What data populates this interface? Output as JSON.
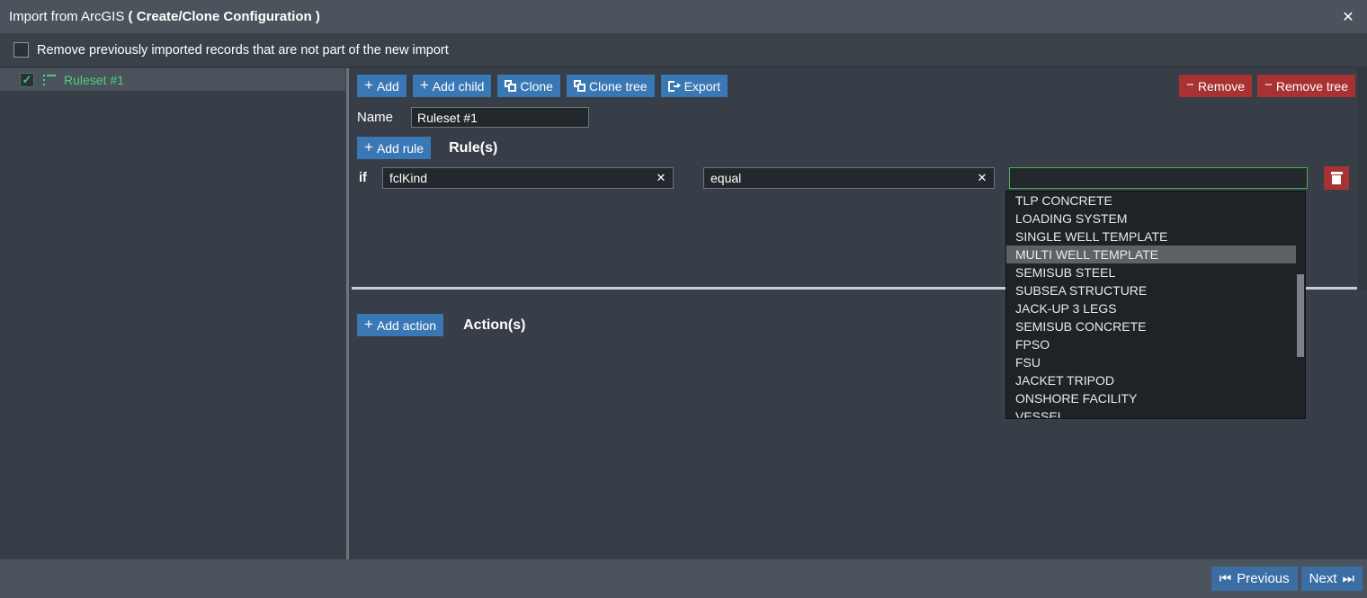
{
  "window": {
    "title_main": "Import from ArcGIS",
    "title_bold": "( Create/Clone Configuration )",
    "close_label": "✕"
  },
  "options": {
    "remove_previous_label": "Remove previously imported records that are not part of the new import",
    "remove_previous_checked": false
  },
  "tree": {
    "items": [
      {
        "label": "Ruleset #1",
        "checked": true,
        "check_glyph": "✓"
      }
    ]
  },
  "toolbar": {
    "add_label": "Add",
    "add_child_label": "Add child",
    "clone_label": "Clone",
    "clone_tree_label": "Clone tree",
    "export_label": "Export",
    "remove_label": "Remove",
    "remove_tree_label": "Remove tree",
    "plus_glyph": "+",
    "minus_glyph": "−"
  },
  "name_field": {
    "label": "Name",
    "value": "Ruleset #1"
  },
  "rules_section": {
    "add_rule_label": "Add rule",
    "title": "Rule(s)",
    "rule": {
      "if_label": "if",
      "field_value": "fclKind",
      "field_clear": "✕",
      "operator_value": "equal",
      "operator_clear": "✕",
      "value_text": ""
    }
  },
  "dropdown": {
    "selected": "MULTI WELL TEMPLATE",
    "items": [
      "TLP CONCRETE",
      "LOADING SYSTEM",
      "SINGLE WELL TEMPLATE",
      "MULTI WELL TEMPLATE",
      "SEMISUB STEEL",
      "SUBSEA STRUCTURE",
      "JACK-UP 3 LEGS",
      "SEMISUB CONCRETE",
      "FPSO",
      "FSU",
      "JACKET TRIPOD",
      "ONSHORE FACILITY",
      "VESSEL"
    ]
  },
  "actions_section": {
    "add_action_label": "Add action",
    "title": "Action(s)"
  },
  "footer": {
    "previous_label": "Previous",
    "next_label": "Next",
    "previous_glyph": "⏮",
    "next_glyph": "⏭"
  },
  "colors": {
    "accent_blue": "#3a78b5",
    "danger_red": "#a83232",
    "tree_green": "#4fcf7d",
    "focus_green": "#4caf50",
    "background": "#373e47",
    "chrome": "#4b545c"
  }
}
